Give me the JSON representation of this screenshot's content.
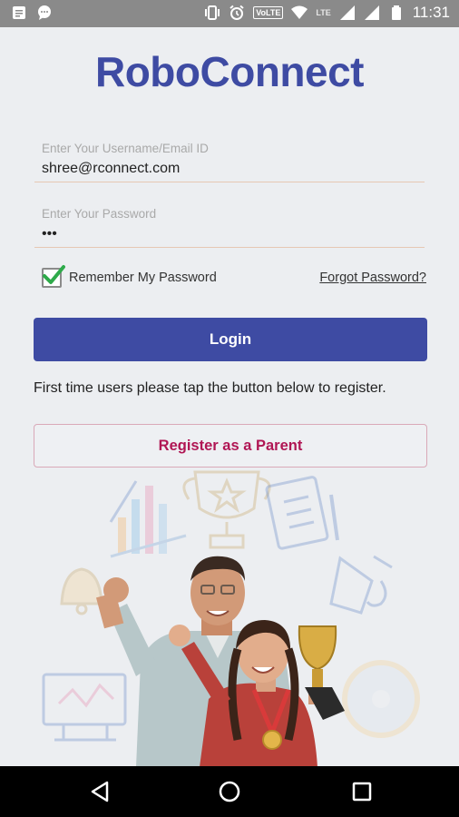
{
  "status_bar": {
    "time": "11:31",
    "network_label": "VoLTE",
    "lte_label": "LTE"
  },
  "app": {
    "title": "RoboConnect"
  },
  "form": {
    "username_label": "Enter Your Username/Email ID",
    "username_value": "shree@rconnect.com",
    "password_label": "Enter Your Password",
    "password_value": "•••",
    "remember_label": "Remember My Password",
    "remember_checked": true,
    "forgot_label": "Forgot Password?"
  },
  "actions": {
    "login_label": "Login",
    "info_text": "First time users please tap the button below to register.",
    "register_label": "Register as a Parent"
  },
  "colors": {
    "brand": "#3e4ba3",
    "register_text": "#b01654",
    "check": "#2eaa4a"
  },
  "icons": [
    "notification-icon",
    "chat-icon",
    "vibrate-icon",
    "alarm-icon",
    "wifi-icon",
    "signal-icon",
    "battery-icon",
    "back-icon",
    "home-icon",
    "recents-icon"
  ]
}
